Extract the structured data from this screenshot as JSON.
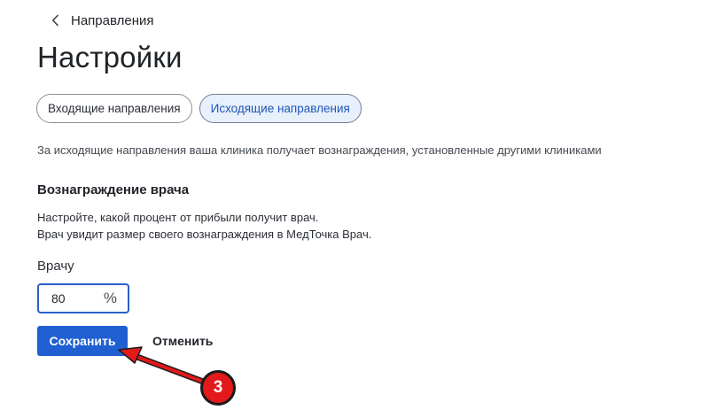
{
  "header": {
    "back_label": "Направления",
    "back_icon": "chevron-left-icon"
  },
  "page": {
    "title": "Настройки"
  },
  "tabs": [
    {
      "label": "Входящие направления",
      "active": false
    },
    {
      "label": "Исходящие направления",
      "active": true
    }
  ],
  "description": "За исходящие направления ваша клиника получает вознаграждения, установленные другими клиниками",
  "reward_section": {
    "title": "Вознаграждение врача",
    "help_line_1": "Настройте, какой процент от прибыли получит врач.",
    "help_line_2": "Врач увидит размер своего вознаграждения в МедТочка Врач.",
    "field_label": "Врачу",
    "field_value": "80",
    "field_unit": "%"
  },
  "actions": {
    "save_label": "Сохранить",
    "cancel_label": "Отменить"
  },
  "annotation": {
    "step_number": "3",
    "color": "#e3191b"
  },
  "colors": {
    "primary": "#1f5fd1",
    "active_tab_bg": "#e8f0fb",
    "active_tab_text": "#1e56b8"
  }
}
